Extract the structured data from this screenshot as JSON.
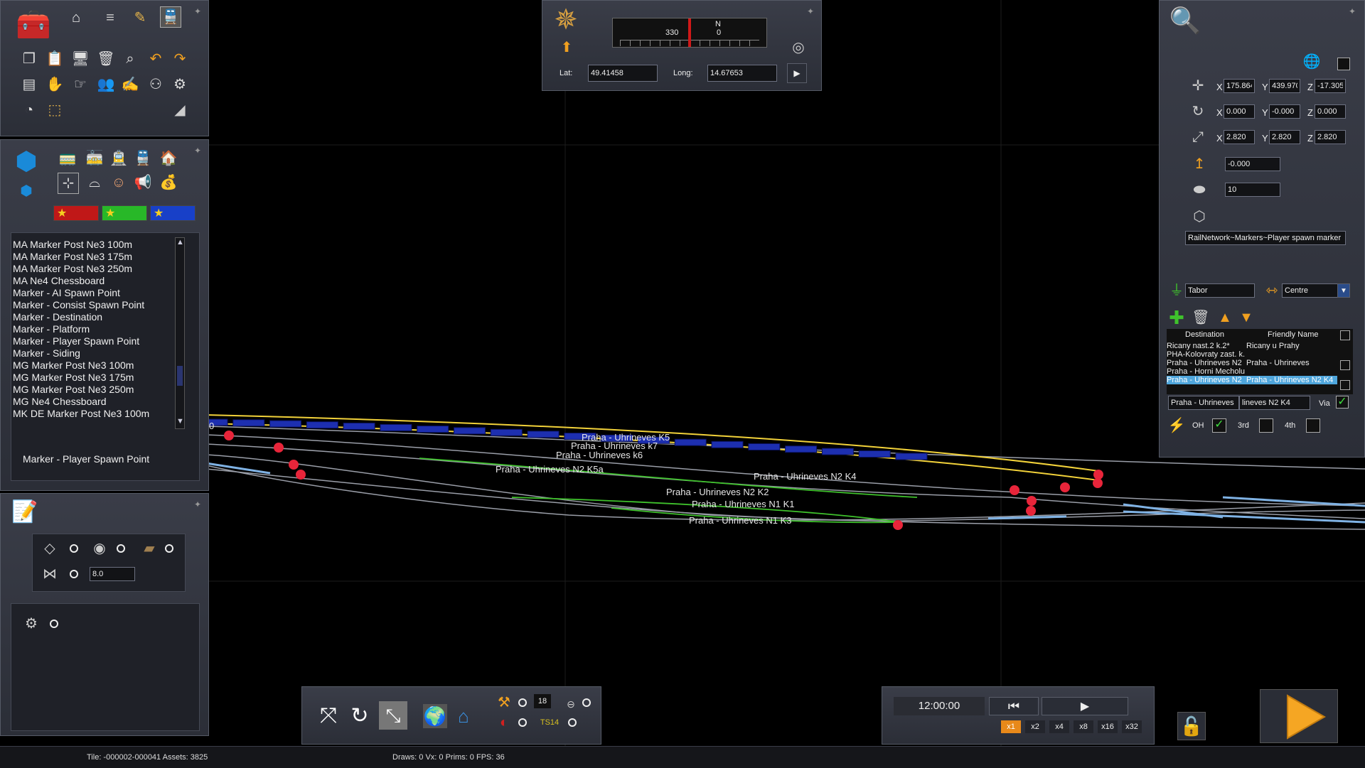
{
  "viewport": {
    "track_labels": [
      "Praha - Uhrineves K5",
      "Praha - Uhrineves k7",
      "Praha - Uhrineves k6",
      "Praha - Uhrineves N2 K5a",
      "Praha - Uhrineves N2 K4",
      "Praha - Uhrineves N2 K2",
      "Praha - Uhrineves N1 K1",
      "Praha - Uhrineves N1 K3"
    ],
    "edge_label": "0"
  },
  "compass": {
    "heading_left": "330",
    "heading_n": "N",
    "heading_right": "0",
    "lat_label": "Lat:",
    "lat_value": "49.41458",
    "long_label": "Long:",
    "long_value": "14.67653"
  },
  "asset_browser": {
    "items": [
      "MA Marker Post Ne3 100m",
      "MA Marker Post Ne3 175m",
      "MA Marker Post Ne3 250m",
      "MA Ne4 Chessboard",
      "Marker - AI Spawn Point",
      "Marker - Consist Spawn Point",
      "Marker - Destination",
      "Marker - Platform",
      "Marker - Player Spawn Point",
      "Marker - Siding",
      "MG Marker Post Ne3 100m",
      "MG Marker Post Ne3 175m",
      "MG Marker Post Ne3 250m",
      "MG Ne4 Chessboard",
      "MK DE Marker Post Ne3 100m"
    ],
    "selected": "Marker - Player Spawn Point"
  },
  "tools_panel": {
    "spacing_value": "8.0"
  },
  "properties": {
    "position": {
      "x_label": "X",
      "x": "175.864",
      "y_label": "Y",
      "y": "439.970",
      "z_label": "Z",
      "z": "-17.305"
    },
    "rotation": {
      "x_label": "X",
      "x": "0.000",
      "y_label": "Y",
      "y": "-0.000",
      "z_label": "Z",
      "z": "0.000"
    },
    "scale": {
      "x_label": "X",
      "x": "2.820",
      "y_label": "Y",
      "y": "2.820",
      "z_label": "Z",
      "z": "2.820"
    },
    "height": "-0.000",
    "count": "10",
    "asset_path": "RailNetwork~Markers~Player spawn marker",
    "station": "Tabor",
    "alignment": "Centre",
    "col_destination": "Destination",
    "col_friendly": "Friendly Name",
    "rows": [
      {
        "dest": "Ricany nast.2 k.2*",
        "friendly": "Ricany u Prahy"
      },
      {
        "dest": "PHA-Kolovraty zast. k.",
        "friendly": ""
      },
      {
        "dest": "Praha - Uhrineves N2 ",
        "friendly": "Praha - Uhrineves"
      },
      {
        "dest": "Praha - Horni Mecholu",
        "friendly": ""
      },
      {
        "dest": "Praha - Uhrineves N2 ",
        "friendly": "Praha - Uhrineves N2 K4"
      }
    ],
    "edit_dest": "Praha - Uhrineves",
    "edit_friendly": "lineves N2 K4",
    "via_label": "Via",
    "oh_label": "OH",
    "third_label": "3rd",
    "fourth_label": "4th"
  },
  "time_panel": {
    "time": "12:00:00",
    "speeds": [
      "x1",
      "x2",
      "x4",
      "x8",
      "x16",
      "x32"
    ]
  },
  "bottom_toolbar": {
    "counter": "18"
  },
  "status": {
    "tile": "Tile: -000002-000041  Assets: 3825",
    "draws": "Draws: 0 Vx: 0 Prims: 0 FPS: 36"
  },
  "colors": {
    "yellow_track": "#f2d23a",
    "green_track": "#3fc22c",
    "marker_red": "#e8253a",
    "wagon_blue": "#1d2fb0",
    "speed_active": "#e8891a",
    "play_orange": "#f5a623"
  }
}
